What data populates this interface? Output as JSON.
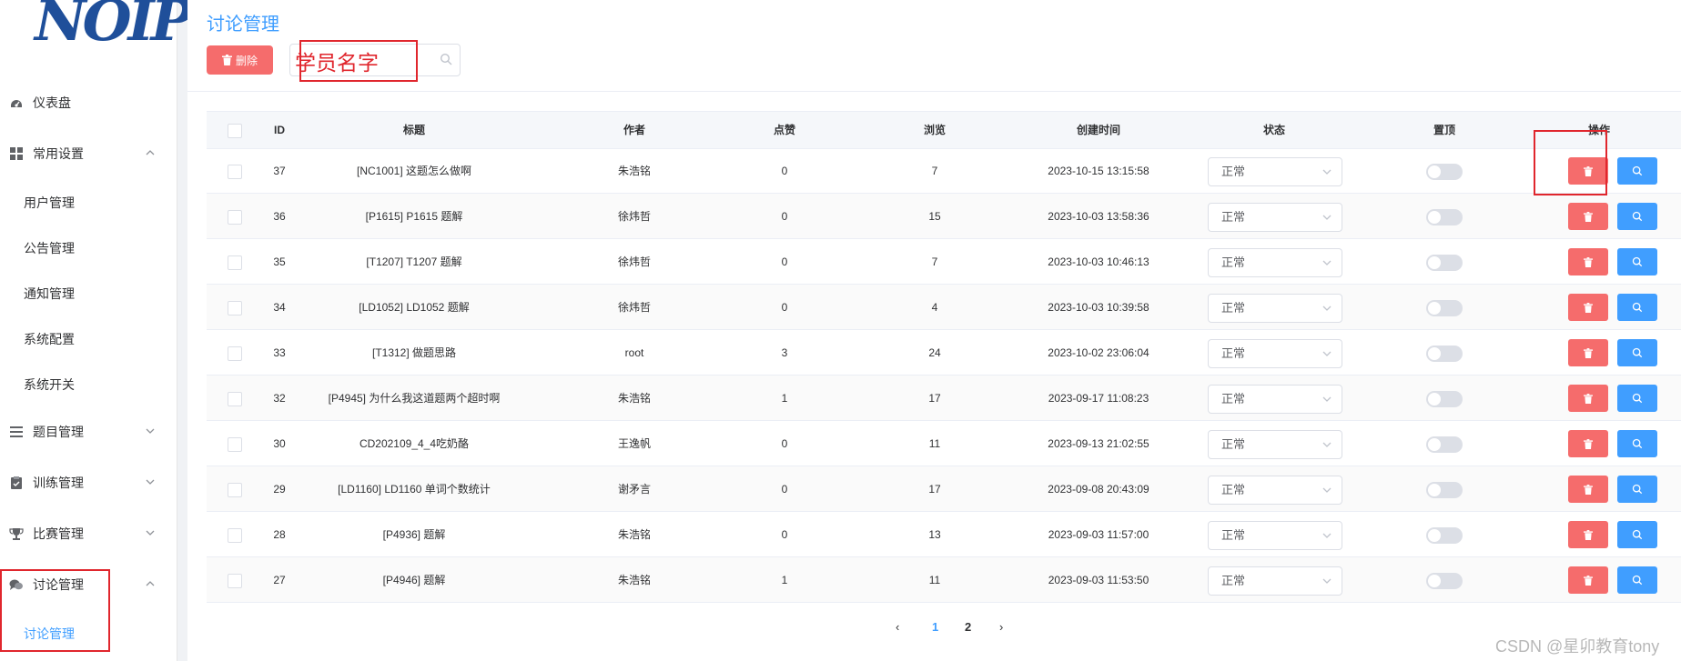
{
  "logo_text": "NOIP",
  "sidebar": {
    "items": [
      {
        "icon": "dashboard-icon",
        "label": "仪表盘",
        "chevron": null
      },
      {
        "icon": "grid-icon",
        "label": "常用设置",
        "chevron": "up"
      },
      {
        "icon": "list-icon",
        "label": "题目管理",
        "chevron": "down"
      },
      {
        "icon": "clipboard-icon",
        "label": "训练管理",
        "chevron": "down"
      },
      {
        "icon": "trophy-icon",
        "label": "比赛管理",
        "chevron": "down"
      },
      {
        "icon": "chat-icon",
        "label": "讨论管理",
        "chevron": "up"
      }
    ],
    "settings_sub": [
      "用户管理",
      "公告管理",
      "通知管理",
      "系统配置",
      "系统开关"
    ],
    "discussion_sub": [
      "讨论管理"
    ]
  },
  "page": {
    "title": "讨论管理",
    "delete_label": "删除",
    "search_placeholder": "",
    "annotation": "学员名字"
  },
  "table": {
    "headers": [
      "ID",
      "标题",
      "作者",
      "点赞",
      "浏览",
      "创建时间",
      "状态",
      "置顶",
      "操作"
    ],
    "rows": [
      {
        "id": "37",
        "title": "[NC1001] 这题怎么做啊",
        "author": "朱浩铭",
        "likes": "0",
        "views": "7",
        "created": "2023-10-15 13:15:58",
        "status": "正常",
        "pinned": false
      },
      {
        "id": "36",
        "title": "[P1615] P1615 题解",
        "author": "徐炜哲",
        "likes": "0",
        "views": "15",
        "created": "2023-10-03 13:58:36",
        "status": "正常",
        "pinned": false
      },
      {
        "id": "35",
        "title": "[T1207] T1207 题解",
        "author": "徐炜哲",
        "likes": "0",
        "views": "7",
        "created": "2023-10-03 10:46:13",
        "status": "正常",
        "pinned": false
      },
      {
        "id": "34",
        "title": "[LD1052] LD1052 题解",
        "author": "徐炜哲",
        "likes": "0",
        "views": "4",
        "created": "2023-10-03 10:39:58",
        "status": "正常",
        "pinned": false
      },
      {
        "id": "33",
        "title": "[T1312] 做题思路",
        "author": "root",
        "likes": "3",
        "views": "24",
        "created": "2023-10-02 23:06:04",
        "status": "正常",
        "pinned": false
      },
      {
        "id": "32",
        "title": "[P4945] 为什么我这道题两个超时啊",
        "author": "朱浩铭",
        "likes": "1",
        "views": "17",
        "created": "2023-09-17 11:08:23",
        "status": "正常",
        "pinned": false
      },
      {
        "id": "30",
        "title": "CD202109_4_4吃奶酪",
        "author": "王逸帆",
        "likes": "0",
        "views": "11",
        "created": "2023-09-13 21:02:55",
        "status": "正常",
        "pinned": false
      },
      {
        "id": "29",
        "title": "[LD1160] LD1160 单词个数统计",
        "author": "谢矛言",
        "likes": "0",
        "views": "17",
        "created": "2023-09-08 20:43:09",
        "status": "正常",
        "pinned": false
      },
      {
        "id": "28",
        "title": "[P4936] 题解",
        "author": "朱浩铭",
        "likes": "0",
        "views": "13",
        "created": "2023-09-03 11:57:00",
        "status": "正常",
        "pinned": false
      },
      {
        "id": "27",
        "title": "[P4946] 题解",
        "author": "朱浩铭",
        "likes": "1",
        "views": "11",
        "created": "2023-09-03 11:53:50",
        "status": "正常",
        "pinned": false
      }
    ]
  },
  "pagination": {
    "pages": [
      "1",
      "2"
    ],
    "current": "1",
    "prev": "‹",
    "next": "›"
  },
  "watermark": "CSDN @星卯教育tony",
  "colors": {
    "primary": "#409eff",
    "danger": "#f56c6c",
    "annotation": "#e0262d"
  }
}
